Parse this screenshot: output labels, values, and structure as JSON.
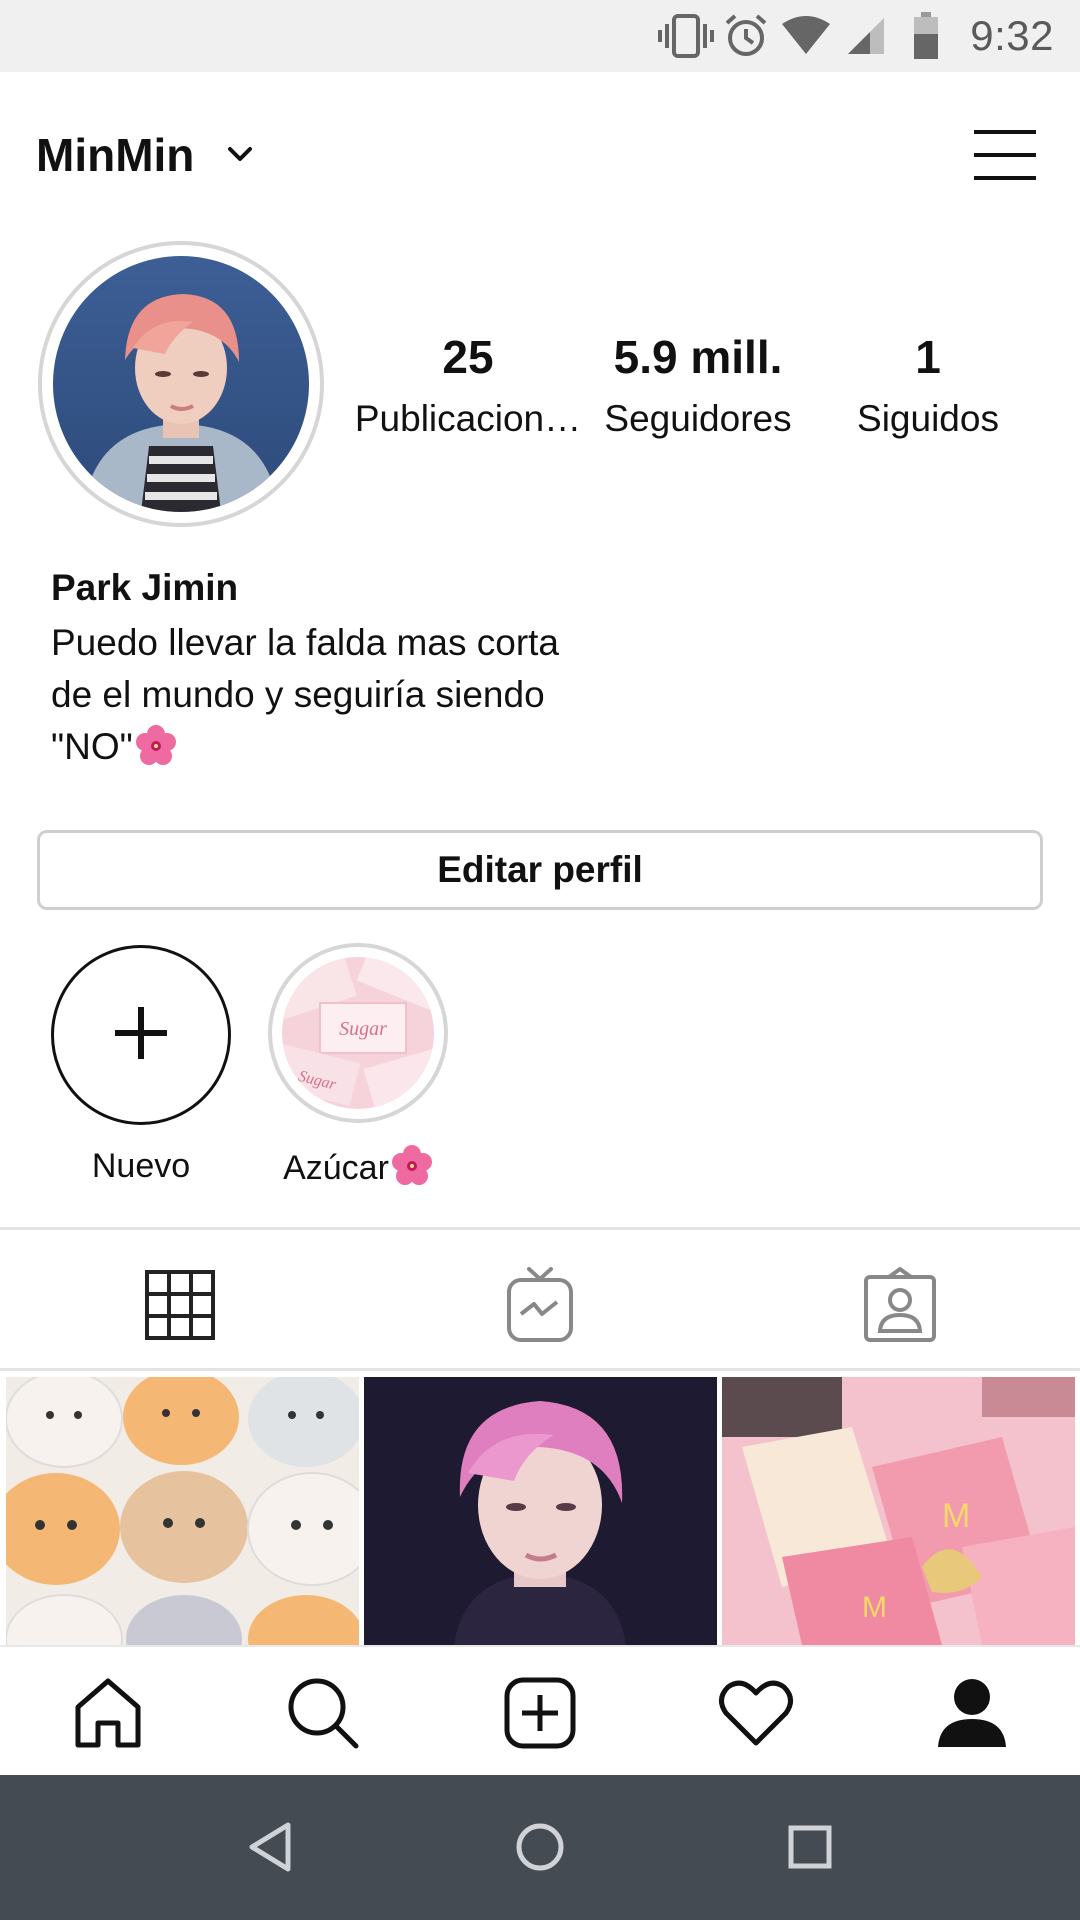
{
  "status_bar": {
    "time": "9:32",
    "icons": [
      "vibrate-icon",
      "alarm-icon",
      "wifi-icon",
      "signal-icon",
      "battery-icon"
    ]
  },
  "header": {
    "username": "MinMin"
  },
  "stats": {
    "posts_value": "25",
    "posts_label": "Publicacion…",
    "followers_value": "5.9 mill.",
    "followers_label": "Seguidores",
    "following_value": "1",
    "following_label": "Siguidos"
  },
  "bio": {
    "name": "Park Jimin",
    "line1": "Puedo llevar la falda mas corta",
    "line2": "de el mundo y seguiría siendo",
    "line3": "\"NO\""
  },
  "edit_profile_label": "Editar perfil",
  "highlights": [
    {
      "label": "Nuevo"
    },
    {
      "label": "Azúcar",
      "cover_text": "Sugar"
    }
  ],
  "tabs": [
    "grid-icon",
    "igtv-icon",
    "tagged-icon"
  ],
  "bottom_nav": [
    "home-icon",
    "search-icon",
    "add-post-icon",
    "heart-icon",
    "profile-icon"
  ],
  "colors": {
    "status_bar_bg": "#f0f0f0",
    "system_nav_bg": "#454b53",
    "border": "#d6d6d6",
    "flower": "#e8457f"
  }
}
